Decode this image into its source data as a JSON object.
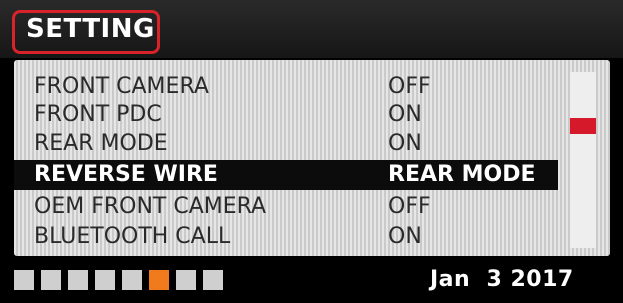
{
  "header": {
    "title": "SETTING"
  },
  "menu": {
    "items": [
      {
        "label": "FRONT CAMERA",
        "value": "OFF",
        "selected": false
      },
      {
        "label": "FRONT PDC",
        "value": "ON",
        "selected": false
      },
      {
        "label": "REAR MODE",
        "value": "ON",
        "selected": false
      },
      {
        "label": "REVERSE WIRE",
        "value": "REAR MODE",
        "selected": true
      },
      {
        "label": "OEM FRONT CAMERA",
        "value": "OFF",
        "selected": false
      },
      {
        "label": "BLUETOOTH CALL",
        "value": "ON",
        "selected": false
      }
    ]
  },
  "pager": {
    "total": 8,
    "active_index": 5
  },
  "status": {
    "date": "Jan  3 2017"
  },
  "colors": {
    "highlight_border": "#d9232b",
    "scroll_thumb": "#d6182b",
    "active_page": "#f07b1d",
    "selected_row_bg": "#0c0c0c"
  }
}
